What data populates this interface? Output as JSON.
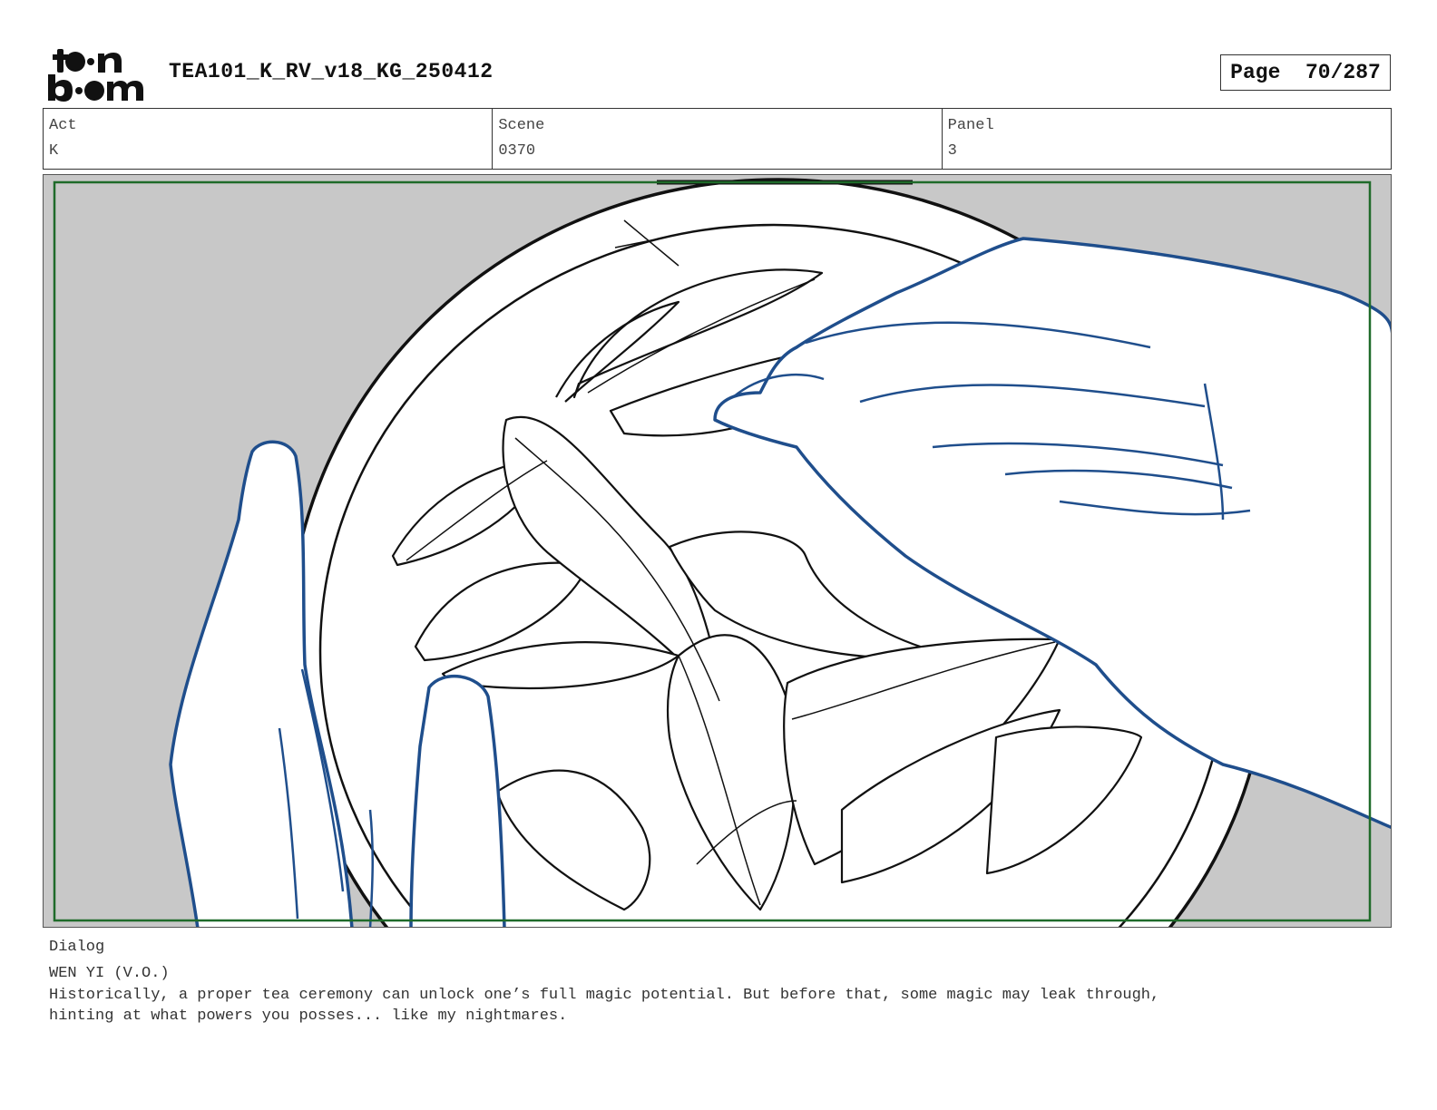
{
  "header": {
    "logo_text": "toon boom",
    "document_title": "TEA101_K_RV_v18_KG_250412",
    "page_label": "Page",
    "page_number": "70/287"
  },
  "info": {
    "act_label": "Act",
    "act_value": "K",
    "scene_label": "Scene",
    "scene_value": "0370",
    "panel_label": "Panel",
    "panel_value": "3"
  },
  "dialog": {
    "label": "Dialog",
    "speaker": "WEN YI (V.O.)",
    "text": "Historically, a proper tea ceremony can unlock one’s full magic potential. But before that, some magic may leak through,\nhinting at what powers you posses... like my nightmares."
  },
  "colors": {
    "background_gray": "#c8c8c8",
    "safe_frame_green": "#1f6b2a",
    "hand_line_blue": "#1f4e8c",
    "line_black": "#111111"
  }
}
